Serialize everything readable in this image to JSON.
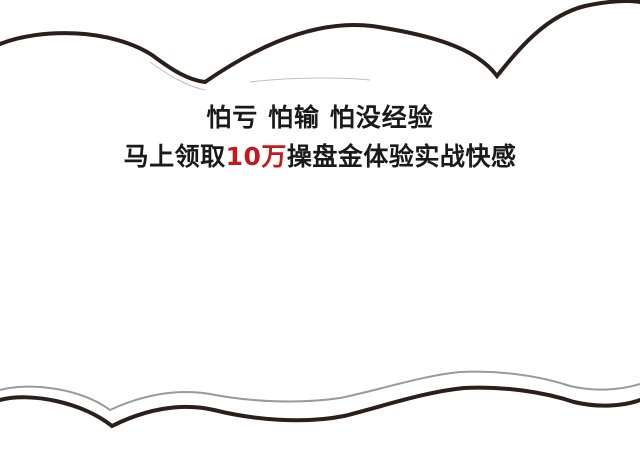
{
  "banner": {
    "line1": "怕亏 怕输 怕没经验",
    "line2_prefix": "马上领取",
    "line2_highlight": "10万",
    "line2_suffix": "操盘金体验实战快感"
  },
  "colors": {
    "text": "#1a1a1a",
    "highlight": "#c8161d",
    "cloud_fill": "#ffffff",
    "cloud_outline": "#2a1f1a"
  }
}
